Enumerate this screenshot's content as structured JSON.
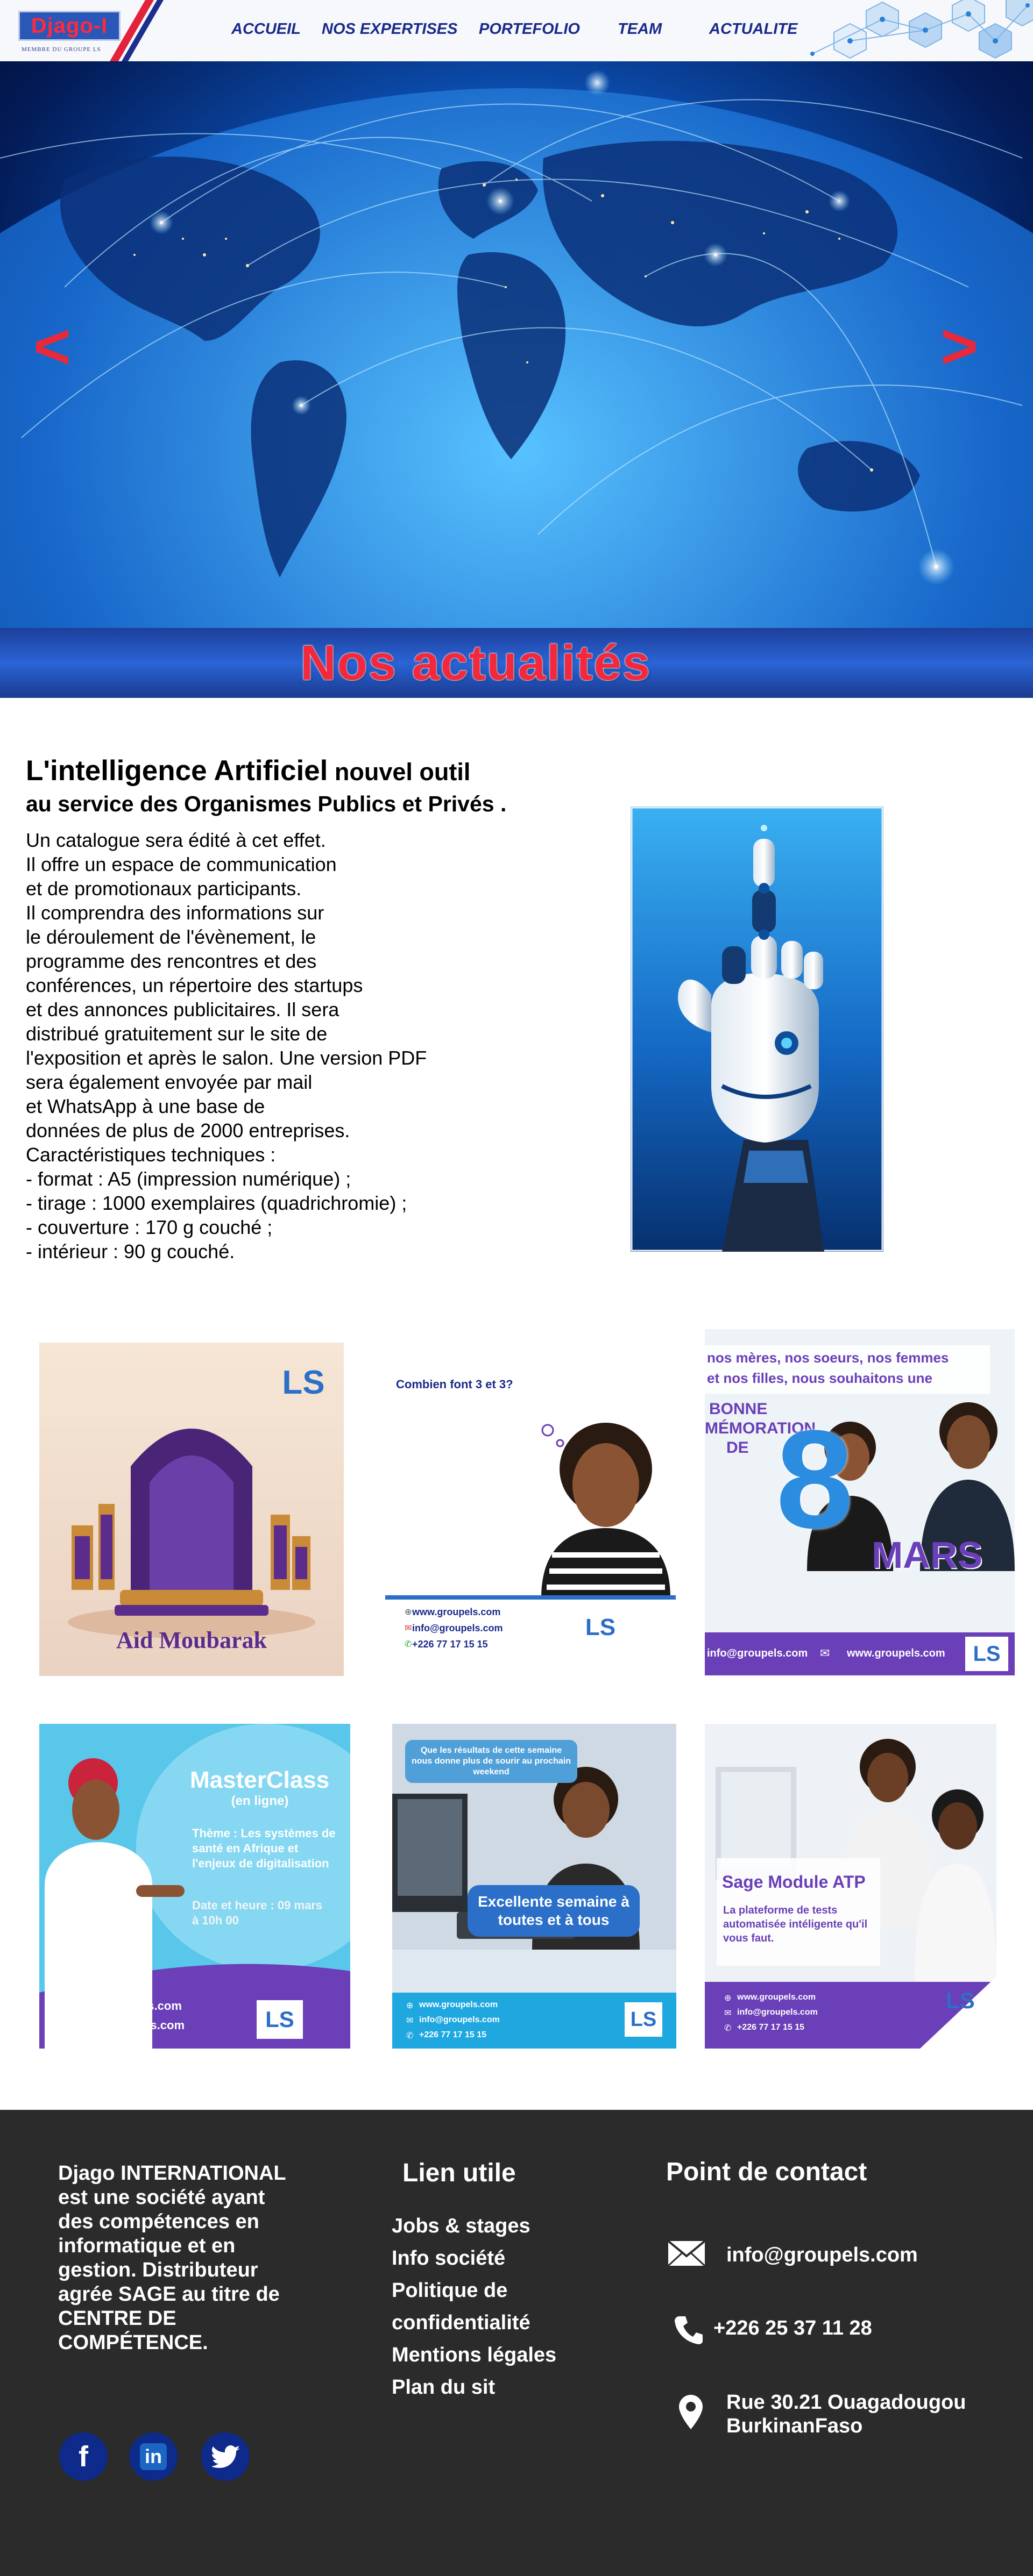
{
  "header": {
    "logo_text": "Djago-I",
    "logo_tagline": "MEMBRE DU GROUPE LS",
    "nav": [
      {
        "label": "ACCUEIL"
      },
      {
        "label": "NOS EXPERTISES"
      },
      {
        "label": "PORTEFOLIO"
      },
      {
        "label": "TEAM"
      },
      {
        "label": "ACTUALITE"
      }
    ]
  },
  "hero": {
    "prev_label": "<",
    "next_label": ">"
  },
  "banner": {
    "title": "Nos actualités"
  },
  "article": {
    "title_main": "L'intelligence Artificiel",
    "title_small": " nouvel outil",
    "subtitle": "au service des Organismes Publics et Privés .",
    "body": "Un catalogue sera édité à cet effet.\nIl offre un espace de communication\net de promotionaux participants.\n Il comprendra des informations sur\nle déroulement de l'évènement, le\nprogramme des rencontres et des\nconférences, un répertoire des startups\net des annonces publicitaires. Il sera\ndistribué gratuitement sur le site de\nl'exposition et après le salon. Une version PDF\nsera également envoyée par mail\net WhatsApp à une base de\ndonnées de plus de 2000 entreprises.\nCaractéristiques techniques :\n- format : A5 (impression numérique) ;\n- tirage : 1000 exemplaires (quadrichromie) ;\n- couverture : 170 g couché ;\n- intérieur : 90 g couché."
  },
  "gallery": {
    "card1": {
      "caption": "Aid Moubarak",
      "logo": "LS"
    },
    "card2": {
      "question": "Combien font 3 et 3?",
      "web": "www.groupels.com",
      "mail": "info@groupels.com",
      "phone": "+226 77 17 15 15",
      "logo": "LS"
    },
    "card3": {
      "line1": "nos mères, nos soeurs, nos femmes",
      "line2": "et nos filles, nous souhaitons une",
      "bonne": "BONNE",
      "memoration": "MÉMORATION",
      "de": "DE",
      "day": "8",
      "month": "MARS",
      "mail": "info@groupels.com",
      "web": "www.groupels.com",
      "logo": "LS"
    },
    "card4": {
      "title": "MasterClass",
      "subtitle": "(en ligne)",
      "theme": "Thème : Les systèmes de santé en Afrique et l'enjeux de digitalisation",
      "date": "Date et heure : 09 mars à 10h 00",
      "web": "www.groupels.com",
      "mail": "info@groupels.com",
      "logo": "LS"
    },
    "card5": {
      "bubble": "Que les résultats de cette semaine nous donne plus de sourir au prochain weekend",
      "message": "Excellente semaine à toutes et à tous",
      "web": "www.groupels.com",
      "mail": "info@groupels.com",
      "phone": "+226 77 17 15 15",
      "logo": "LS"
    },
    "card6": {
      "title": "Sage Module ATP",
      "text": "La plateforme de tests automatisée intéligente qu'il vous faut.",
      "web": "www.groupels.com",
      "mail": "info@groupels.com",
      "phone": "+226 77 17 15 15",
      "logo": "LS"
    }
  },
  "footer": {
    "about": "Djago INTERNATIONAL est une société ayant des compétences en informatique et en gestion. Distributeur agrée SAGE au titre de CENTRE DE COMPÉTENCE.",
    "links_title": "Lien utile",
    "links": [
      {
        "label": "Jobs & stages"
      },
      {
        "label": "Info société"
      },
      {
        "label": "Politique de"
      },
      {
        "label": "confidentialité"
      },
      {
        "label": "Mentions légales"
      },
      {
        "label": "Plan du sit"
      }
    ],
    "contact_title": "Point de contact",
    "email": "info@groupels.com",
    "phone": "+226 25 37 11 28",
    "address_line1": "Rue 30.21 Ouagadougou",
    "address_line2": "BurkinanFaso",
    "social": [
      {
        "icon": "facebook-icon",
        "glyph": "f"
      },
      {
        "icon": "linkedin-icon",
        "glyph": "in"
      },
      {
        "icon": "twitter-icon",
        "glyph": "t"
      }
    ]
  },
  "colors": {
    "brand_blue": "#1a2a8a",
    "accent_red": "#f3283c",
    "footer_bg": "#2b2b2b",
    "purple": "#6a3fb8"
  }
}
